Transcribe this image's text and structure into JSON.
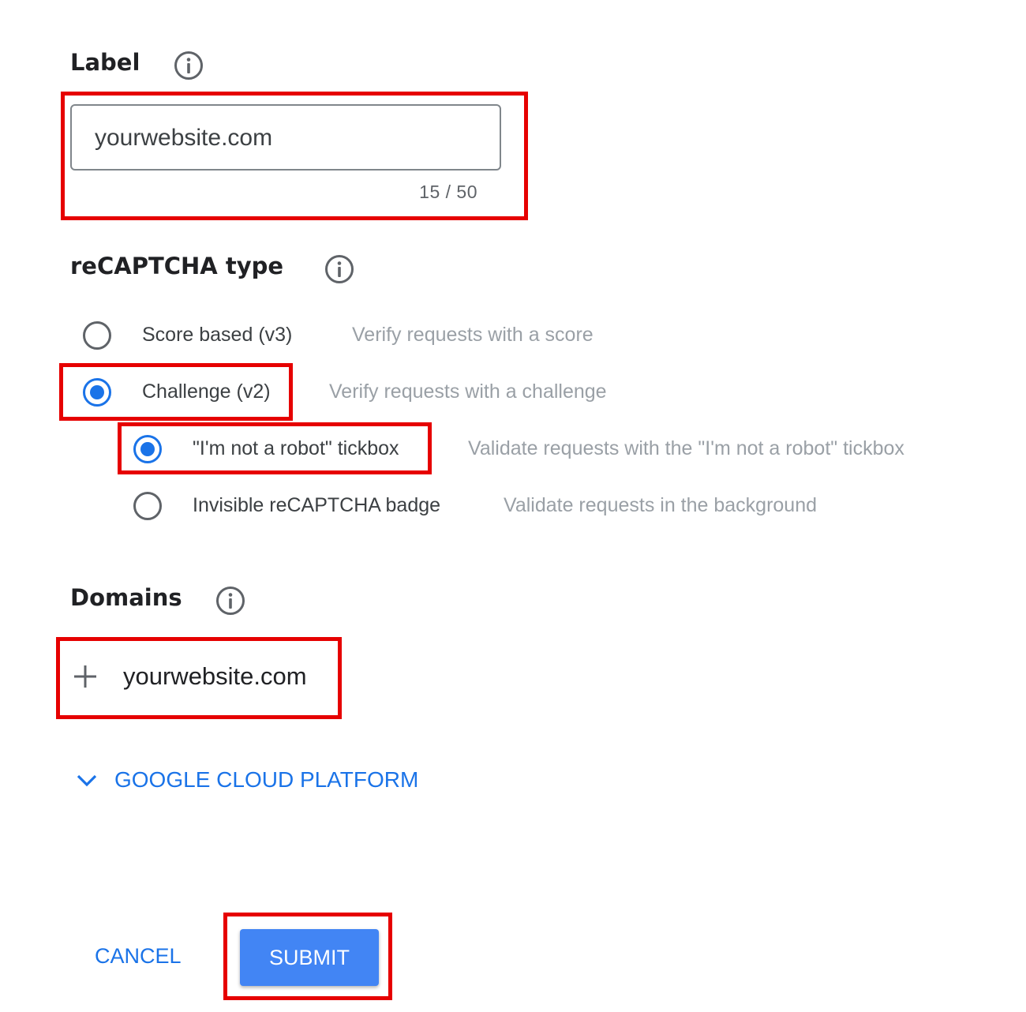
{
  "label_section": {
    "title": "Label",
    "info_icon": "info-icon",
    "input_value": "yourwebsite.com",
    "char_counter": "15 / 50"
  },
  "type_section": {
    "title": "reCAPTCHA type",
    "info_icon": "info-icon",
    "options": [
      {
        "label": "Score based (v3)",
        "description": "Verify requests with a score",
        "checked": false
      },
      {
        "label": "Challenge (v2)",
        "description": "Verify requests with a challenge",
        "checked": true
      }
    ],
    "sub_options": [
      {
        "label": "\"I'm not a robot\" tickbox",
        "description": "Validate requests with the \"I'm not a robot\" tickbox",
        "checked": true
      },
      {
        "label": "Invisible reCAPTCHA badge",
        "description": "Validate requests in the background",
        "checked": false
      }
    ]
  },
  "domains_section": {
    "title": "Domains",
    "info_icon": "info-icon",
    "add_icon": "plus-icon",
    "domain": "yourwebsite.com"
  },
  "advanced": {
    "icon": "chevron-down-icon",
    "label": "GOOGLE CLOUD PLATFORM"
  },
  "actions": {
    "cancel_label": "CANCEL",
    "submit_label": "SUBMIT"
  },
  "colors": {
    "accent_blue": "#1a73e8",
    "submit_blue": "#4285f4",
    "highlight_red": "#e60000",
    "muted_text": "#9aa0a6"
  }
}
